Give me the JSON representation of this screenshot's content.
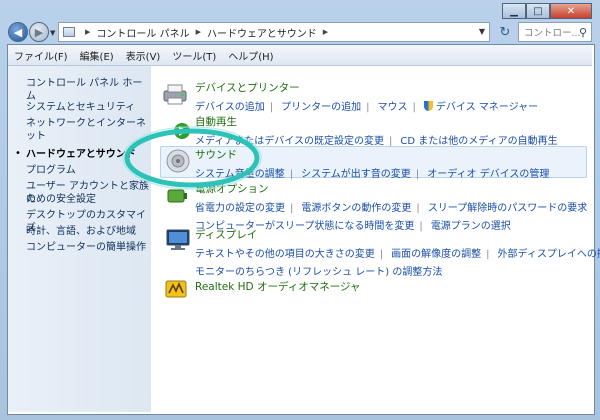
{
  "window": {
    "address_crumbs": [
      "コントロール パネル",
      "ハードウェアとサウンド"
    ],
    "search_placeholder": "コントロー..."
  },
  "menubar": [
    "ファイル(F)",
    "編集(E)",
    "表示(V)",
    "ツール(T)",
    "ヘルプ(H)"
  ],
  "leftnav": {
    "home": "コントロール パネル ホーム",
    "items": [
      "システムとセキュリティ",
      "ネットワークとインターネット",
      "ハードウェアとサウンド",
      "プログラム",
      "ユーザー アカウントと家族の",
      "ための安全設定",
      "デスクトップのカスタマイズ",
      "時計、言語、および地域",
      "コンピューターの簡単操作"
    ]
  },
  "categories": {
    "devices": {
      "title": "デバイスとプリンター",
      "links": [
        "デバイスの追加",
        "プリンターの追加",
        "マウス",
        "デバイス マネージャー"
      ]
    },
    "autoplay": {
      "title": "自動再生",
      "links": [
        "メディアまたはデバイスの既定設定の変更",
        "CD または他のメディアの自動再生"
      ]
    },
    "sound": {
      "title": "サウンド",
      "links": [
        "システム音量の調整",
        "システムが出す音の変更",
        "オーディオ デバイスの管理"
      ]
    },
    "power": {
      "title": "電源オプション",
      "links": [
        "省電力の設定の変更",
        "電源ボタンの動作の変更",
        "スリープ解除時のパスワードの要求",
        "コンピューターがスリープ状態になる時間を変更",
        "電源プランの選択"
      ]
    },
    "display": {
      "title": "ディスプレイ",
      "links": [
        "テキストやその他の項目の大きさの変更",
        "画面の解像度の調整",
        "外部ディスプレイへの接続",
        "モニターのちらつき (リフレッシュ レート) の調整方法"
      ]
    },
    "realtek": {
      "title": "Realtek HD オーディオマネージャ"
    }
  },
  "colors": {
    "category_title": "#1e6e0e",
    "link": "#1a4ea8",
    "highlight_ring": "#2dc2b8"
  }
}
